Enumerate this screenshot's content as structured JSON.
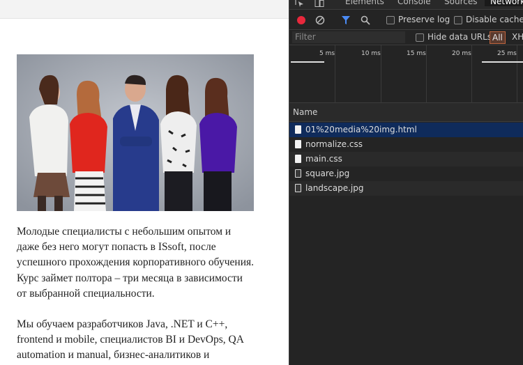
{
  "page": {
    "paragraph1": "Молодые специалисты с небольшим опытом и даже без него могут попасть в ISsoft, после успешного прохождения корпоративного обучения. Курс займет полтора – три месяца в зависимости от выбранной специальности.",
    "paragraph2": "Мы обучаем разработчиков Java, .NET и C++, frontend и mobile, специалистов BI и DevOps, QA automation и manual, бизнес-аналитиков и"
  },
  "devtools": {
    "tabs": [
      "Elements",
      "Console",
      "Sources",
      "Network"
    ],
    "active_tab": "Network",
    "toolbar": {
      "preserve_log": "Preserve log",
      "disable_cache": "Disable cache"
    },
    "filter": {
      "placeholder": "Filter",
      "hide_data_urls": "Hide data URLs",
      "all": "All",
      "xhr": "XH"
    },
    "timeline_ticks": [
      "5 ms",
      "10 ms",
      "15 ms",
      "20 ms",
      "25 ms"
    ],
    "column_name": "Name",
    "files": [
      {
        "name": "01%20media%20img.html",
        "type": "doc",
        "selected": true
      },
      {
        "name": "normalize.css",
        "type": "doc",
        "selected": false
      },
      {
        "name": "main.css",
        "type": "doc",
        "selected": false
      },
      {
        "name": "square.jpg",
        "type": "img",
        "selected": false
      },
      {
        "name": "landscape.jpg",
        "type": "img",
        "selected": false
      }
    ]
  },
  "colors": {
    "record": "#e8283c",
    "filter_active": "#4b8bf5",
    "selected_row": "#0f2b5b"
  }
}
